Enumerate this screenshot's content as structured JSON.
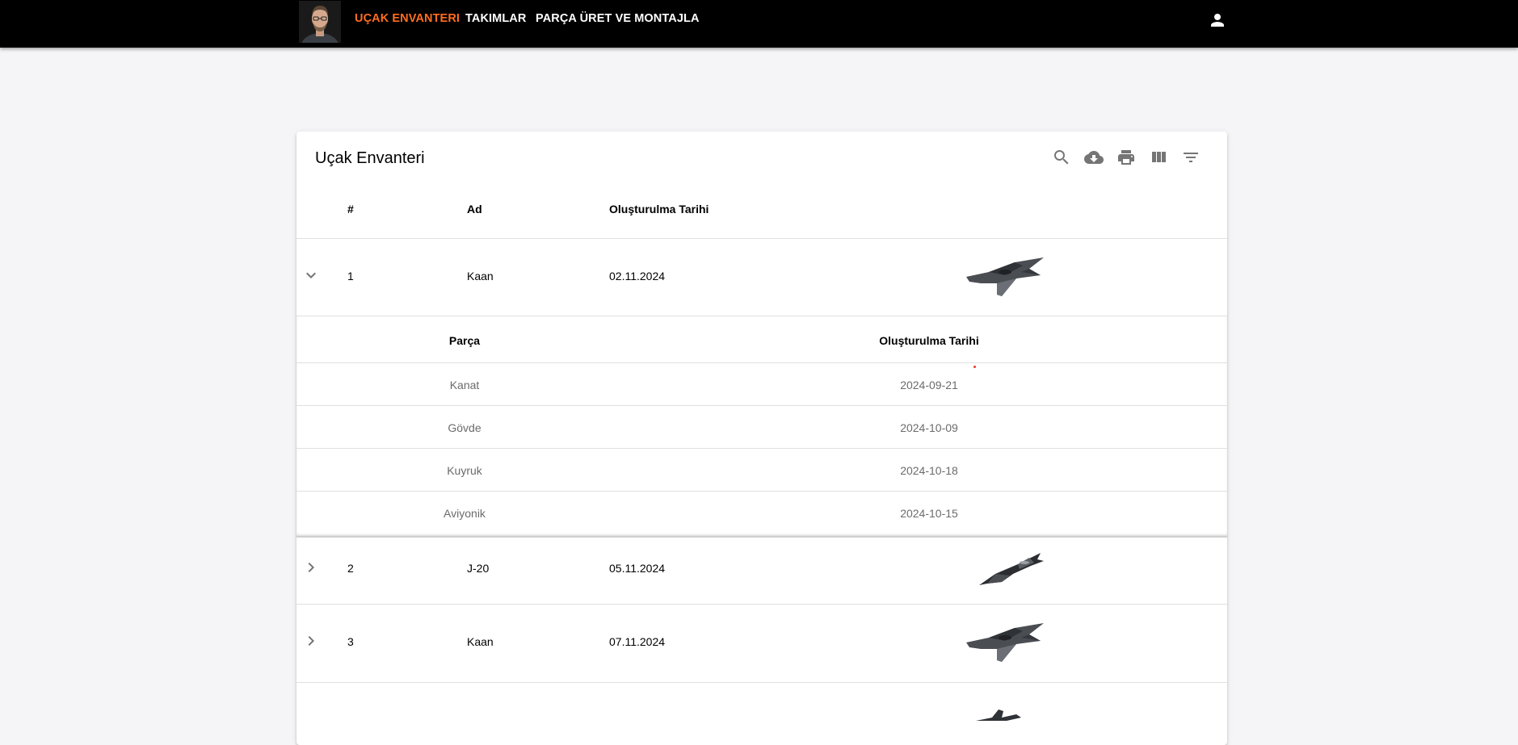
{
  "nav": {
    "items": [
      {
        "label": "UÇAK ENVANTERI",
        "active": true
      },
      {
        "label": "TAKIMLAR",
        "active": false
      },
      {
        "label": "PARÇA ÜRET VE MONTAJLA",
        "active": false
      }
    ],
    "active_color": "#ff6d1f",
    "account_icon": "account-icon"
  },
  "table": {
    "title": "Uçak Envanteri",
    "toolbar_icons": [
      "search-icon",
      "download-icon",
      "print-icon",
      "columns-icon",
      "filter-icon"
    ],
    "columns": [
      "#",
      "Ad",
      "Oluşturulma Tarihi"
    ],
    "rows": [
      {
        "num": "1",
        "name": "Kaan",
        "date": "02.11.2024",
        "expanded": true,
        "image": "kaan-jet"
      },
      {
        "num": "2",
        "name": "J-20",
        "date": "05.11.2024",
        "expanded": false,
        "image": "j20-jet"
      },
      {
        "num": "3",
        "name": "Kaan",
        "date": "07.11.2024",
        "expanded": false,
        "image": "kaan-jet"
      }
    ],
    "detail": {
      "columns": [
        "Parça",
        "Oluşturulma Tarihi"
      ],
      "rows": [
        {
          "part": "Kanat",
          "date": "2024-09-21"
        },
        {
          "part": "Gövde",
          "date": "2024-10-09"
        },
        {
          "part": "Kuyruk",
          "date": "2024-10-18"
        },
        {
          "part": "Aviyonik",
          "date": "2024-10-15"
        }
      ]
    }
  }
}
